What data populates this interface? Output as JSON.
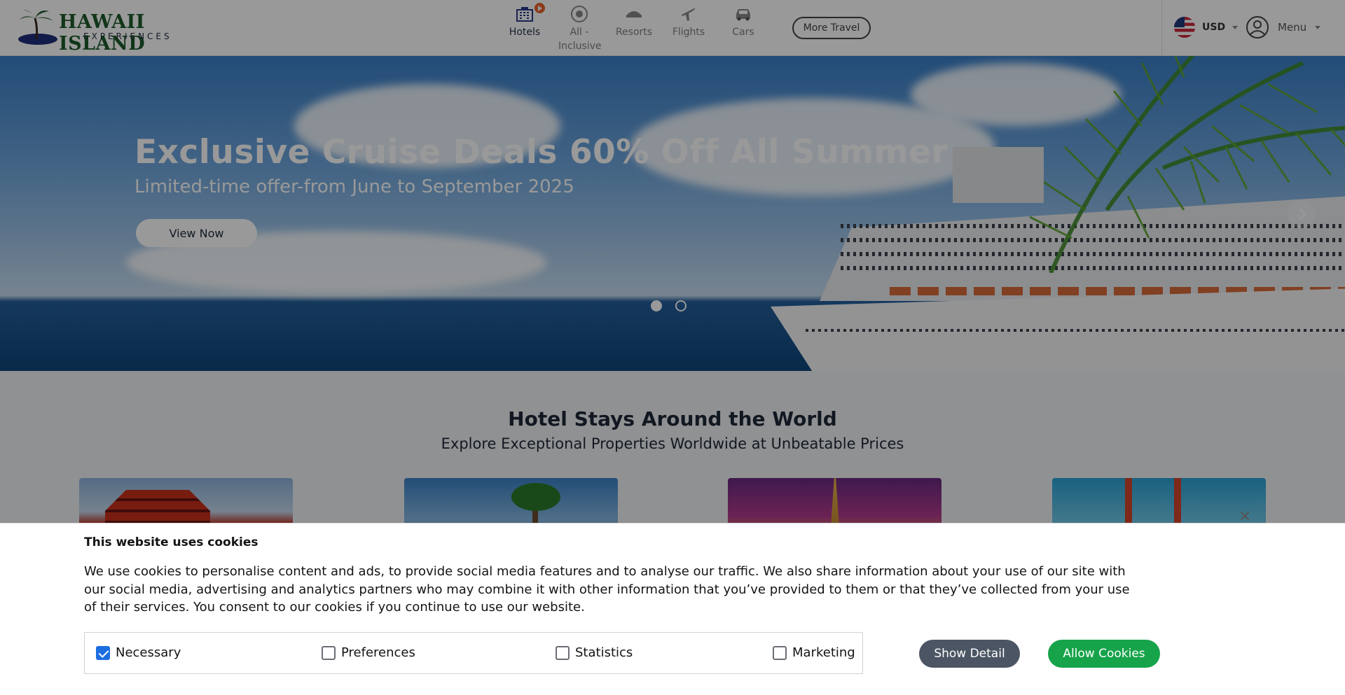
{
  "header": {
    "logo": {
      "main": "HAWAII ISLAND",
      "sub": "EXPERIENCES"
    },
    "nav": [
      {
        "label": "Hotels",
        "icon": "hotel-icon",
        "active": true
      },
      {
        "label": "All - Inclusive",
        "icon": "all-inclusive-icon",
        "active": false
      },
      {
        "label": "Resorts",
        "icon": "resort-icon",
        "active": false
      },
      {
        "label": "Flights",
        "icon": "airplane-icon",
        "active": false
      },
      {
        "label": "Cars",
        "icon": "car-icon",
        "active": false
      }
    ],
    "more_travel": "More Travel",
    "currency": "USD",
    "menu": "Menu"
  },
  "hero": {
    "title": "Exclusive Cruise Deals 60% Off All Summer",
    "subtitle": "Limited-time offer-from June to September 2025",
    "button": "View Now",
    "slides": 2,
    "active_slide": 1
  },
  "section": {
    "title": "Hotel Stays Around the World",
    "subtitle": "Explore Exceptional Properties Worldwide at Unbeatable Prices"
  },
  "cookie": {
    "title": "This website uses cookies",
    "text": "We use cookies to personalise content and ads, to provide social media features and to analyse our traffic. We also share information about your use of our site with our social media, advertising and analytics partners who may combine it with other information that you’ve provided to them or that they’ve collected from your use of their services. You consent to our cookies if you continue to use our website.",
    "options": [
      {
        "label": "Necessary",
        "checked": true
      },
      {
        "label": "Preferences",
        "checked": false
      },
      {
        "label": "Statistics",
        "checked": false
      },
      {
        "label": "Marketing",
        "checked": false
      }
    ],
    "show_detail": "Show Detail",
    "allow": "Allow Cookies"
  },
  "colors": {
    "brand_green": "#1d5a2b",
    "accent_orange": "#e8632b",
    "allow_green": "#16a34a",
    "detail_gray": "#4b5563"
  }
}
